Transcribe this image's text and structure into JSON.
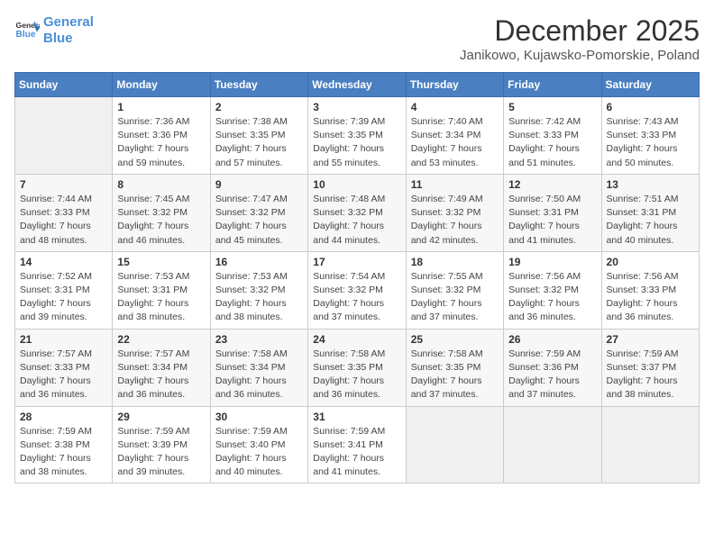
{
  "logo": {
    "line1": "General",
    "line2": "Blue"
  },
  "title": "December 2025",
  "subtitle": "Janikowo, Kujawsko-Pomorskie, Poland",
  "days_of_week": [
    "Sunday",
    "Monday",
    "Tuesday",
    "Wednesday",
    "Thursday",
    "Friday",
    "Saturday"
  ],
  "weeks": [
    [
      {
        "day": "",
        "info": ""
      },
      {
        "day": "1",
        "info": "Sunrise: 7:36 AM\nSunset: 3:36 PM\nDaylight: 7 hours\nand 59 minutes."
      },
      {
        "day": "2",
        "info": "Sunrise: 7:38 AM\nSunset: 3:35 PM\nDaylight: 7 hours\nand 57 minutes."
      },
      {
        "day": "3",
        "info": "Sunrise: 7:39 AM\nSunset: 3:35 PM\nDaylight: 7 hours\nand 55 minutes."
      },
      {
        "day": "4",
        "info": "Sunrise: 7:40 AM\nSunset: 3:34 PM\nDaylight: 7 hours\nand 53 minutes."
      },
      {
        "day": "5",
        "info": "Sunrise: 7:42 AM\nSunset: 3:33 PM\nDaylight: 7 hours\nand 51 minutes."
      },
      {
        "day": "6",
        "info": "Sunrise: 7:43 AM\nSunset: 3:33 PM\nDaylight: 7 hours\nand 50 minutes."
      }
    ],
    [
      {
        "day": "7",
        "info": "Sunrise: 7:44 AM\nSunset: 3:33 PM\nDaylight: 7 hours\nand 48 minutes."
      },
      {
        "day": "8",
        "info": "Sunrise: 7:45 AM\nSunset: 3:32 PM\nDaylight: 7 hours\nand 46 minutes."
      },
      {
        "day": "9",
        "info": "Sunrise: 7:47 AM\nSunset: 3:32 PM\nDaylight: 7 hours\nand 45 minutes."
      },
      {
        "day": "10",
        "info": "Sunrise: 7:48 AM\nSunset: 3:32 PM\nDaylight: 7 hours\nand 44 minutes."
      },
      {
        "day": "11",
        "info": "Sunrise: 7:49 AM\nSunset: 3:32 PM\nDaylight: 7 hours\nand 42 minutes."
      },
      {
        "day": "12",
        "info": "Sunrise: 7:50 AM\nSunset: 3:31 PM\nDaylight: 7 hours\nand 41 minutes."
      },
      {
        "day": "13",
        "info": "Sunrise: 7:51 AM\nSunset: 3:31 PM\nDaylight: 7 hours\nand 40 minutes."
      }
    ],
    [
      {
        "day": "14",
        "info": "Sunrise: 7:52 AM\nSunset: 3:31 PM\nDaylight: 7 hours\nand 39 minutes."
      },
      {
        "day": "15",
        "info": "Sunrise: 7:53 AM\nSunset: 3:31 PM\nDaylight: 7 hours\nand 38 minutes."
      },
      {
        "day": "16",
        "info": "Sunrise: 7:53 AM\nSunset: 3:32 PM\nDaylight: 7 hours\nand 38 minutes."
      },
      {
        "day": "17",
        "info": "Sunrise: 7:54 AM\nSunset: 3:32 PM\nDaylight: 7 hours\nand 37 minutes."
      },
      {
        "day": "18",
        "info": "Sunrise: 7:55 AM\nSunset: 3:32 PM\nDaylight: 7 hours\nand 37 minutes."
      },
      {
        "day": "19",
        "info": "Sunrise: 7:56 AM\nSunset: 3:32 PM\nDaylight: 7 hours\nand 36 minutes."
      },
      {
        "day": "20",
        "info": "Sunrise: 7:56 AM\nSunset: 3:33 PM\nDaylight: 7 hours\nand 36 minutes."
      }
    ],
    [
      {
        "day": "21",
        "info": "Sunrise: 7:57 AM\nSunset: 3:33 PM\nDaylight: 7 hours\nand 36 minutes."
      },
      {
        "day": "22",
        "info": "Sunrise: 7:57 AM\nSunset: 3:34 PM\nDaylight: 7 hours\nand 36 minutes."
      },
      {
        "day": "23",
        "info": "Sunrise: 7:58 AM\nSunset: 3:34 PM\nDaylight: 7 hours\nand 36 minutes."
      },
      {
        "day": "24",
        "info": "Sunrise: 7:58 AM\nSunset: 3:35 PM\nDaylight: 7 hours\nand 36 minutes."
      },
      {
        "day": "25",
        "info": "Sunrise: 7:58 AM\nSunset: 3:35 PM\nDaylight: 7 hours\nand 37 minutes."
      },
      {
        "day": "26",
        "info": "Sunrise: 7:59 AM\nSunset: 3:36 PM\nDaylight: 7 hours\nand 37 minutes."
      },
      {
        "day": "27",
        "info": "Sunrise: 7:59 AM\nSunset: 3:37 PM\nDaylight: 7 hours\nand 38 minutes."
      }
    ],
    [
      {
        "day": "28",
        "info": "Sunrise: 7:59 AM\nSunset: 3:38 PM\nDaylight: 7 hours\nand 38 minutes."
      },
      {
        "day": "29",
        "info": "Sunrise: 7:59 AM\nSunset: 3:39 PM\nDaylight: 7 hours\nand 39 minutes."
      },
      {
        "day": "30",
        "info": "Sunrise: 7:59 AM\nSunset: 3:40 PM\nDaylight: 7 hours\nand 40 minutes."
      },
      {
        "day": "31",
        "info": "Sunrise: 7:59 AM\nSunset: 3:41 PM\nDaylight: 7 hours\nand 41 minutes."
      },
      {
        "day": "",
        "info": ""
      },
      {
        "day": "",
        "info": ""
      },
      {
        "day": "",
        "info": ""
      }
    ]
  ]
}
